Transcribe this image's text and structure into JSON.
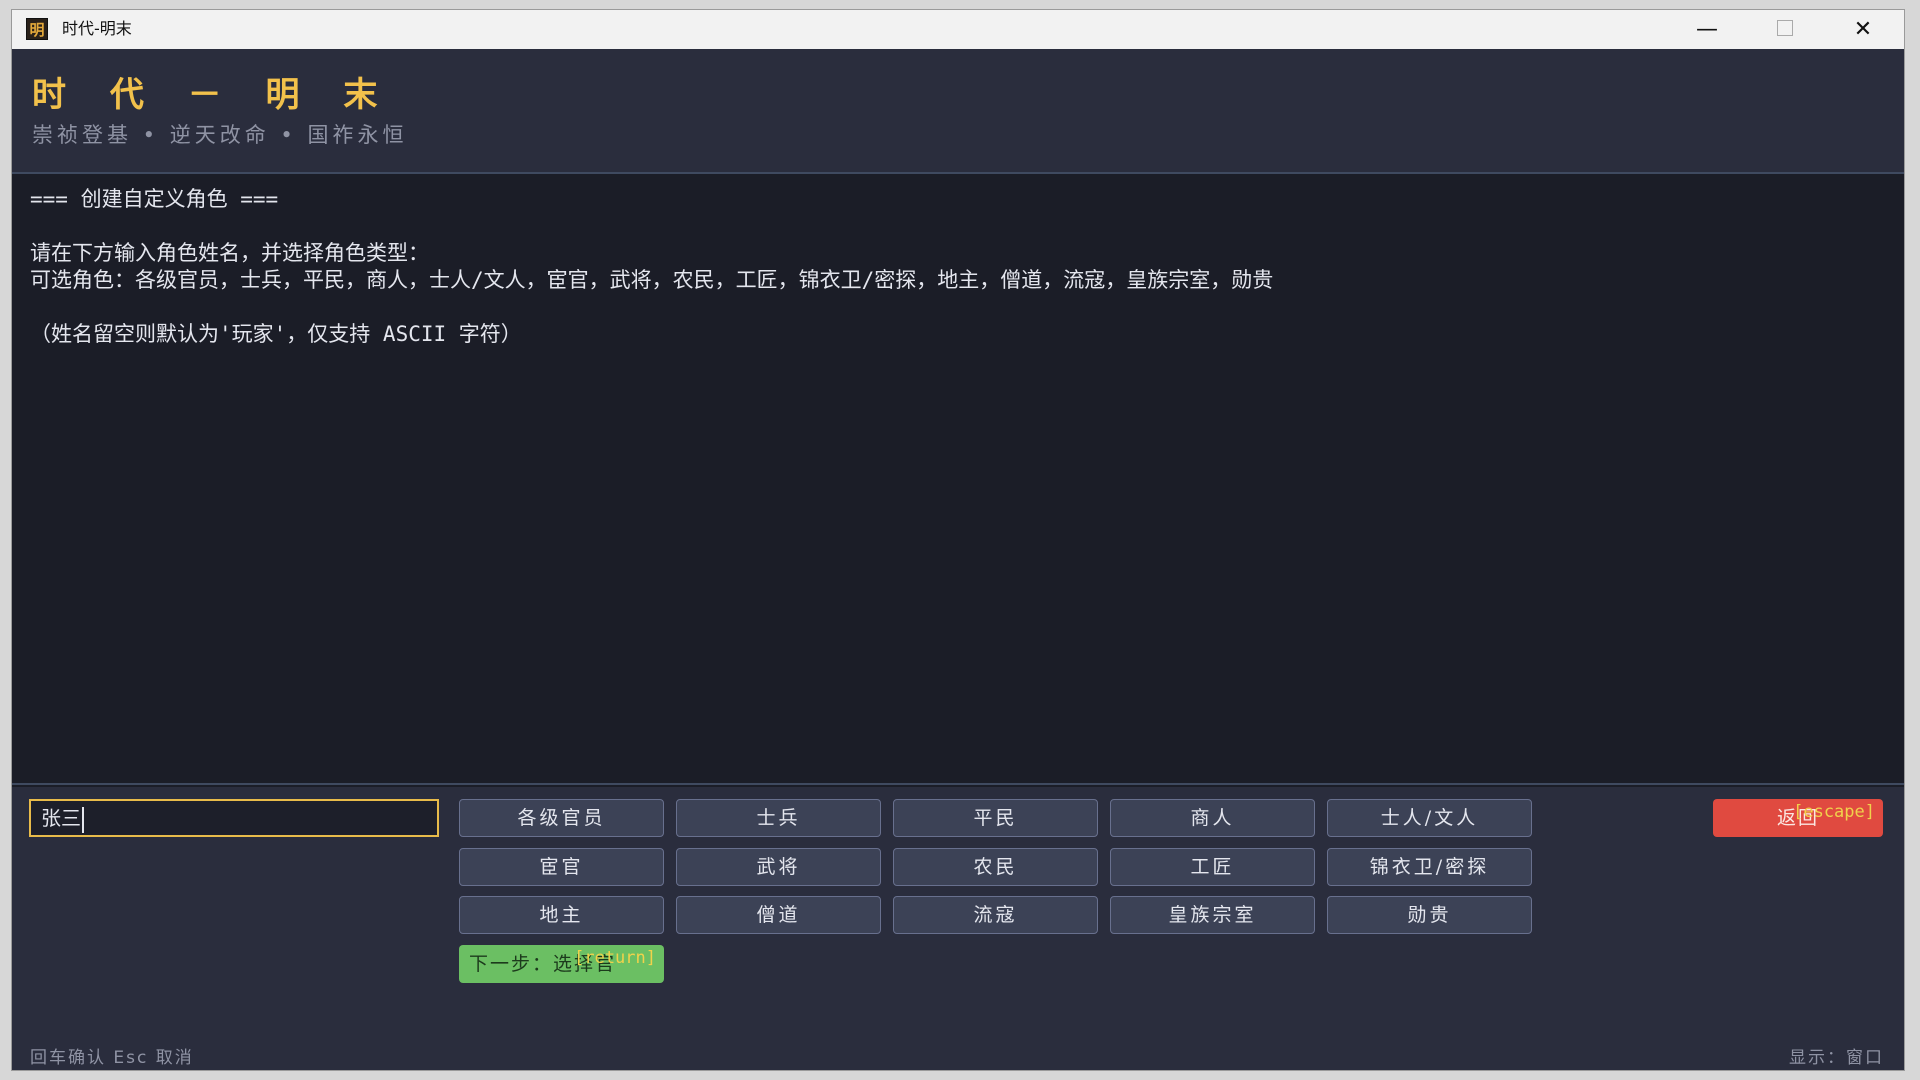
{
  "window": {
    "icon_char": "明",
    "title": "时代-明末",
    "controls": {
      "minimize": "—",
      "close": "✕"
    }
  },
  "header": {
    "title": "时 代 － 明 末",
    "subtitle": "崇祯登基 • 逆天改命 • 国祚永恒"
  },
  "console": {
    "heading": "=== 创建自定义角色 ===",
    "prompt": "请在下方输入角色姓名，并选择角色类型：",
    "options": "可选角色：各级官员，士兵，平民，商人，士人/文人，宦官，武将，农民，工匠，锦衣卫/密探，地主，僧道，流寇，皇族宗室，勋贵",
    "note": "（姓名留空则默认为'玩家'，仅支持 ASCII 字符）"
  },
  "name_input": {
    "value": "张三"
  },
  "roles": [
    "各级官员",
    "士兵",
    "平民",
    "商人",
    "士人/文人",
    "宦官",
    "武将",
    "农民",
    "工匠",
    "锦衣卫/密探",
    "地主",
    "僧道",
    "流寇",
    "皇族宗室",
    "勋贵"
  ],
  "next_button": {
    "label": "下一步：选择官",
    "hint": "[return]"
  },
  "back_button": {
    "label": "返回",
    "hint": "[escape]"
  },
  "status": {
    "left": "回车确认  Esc 取消",
    "right": "显示：窗口"
  }
}
